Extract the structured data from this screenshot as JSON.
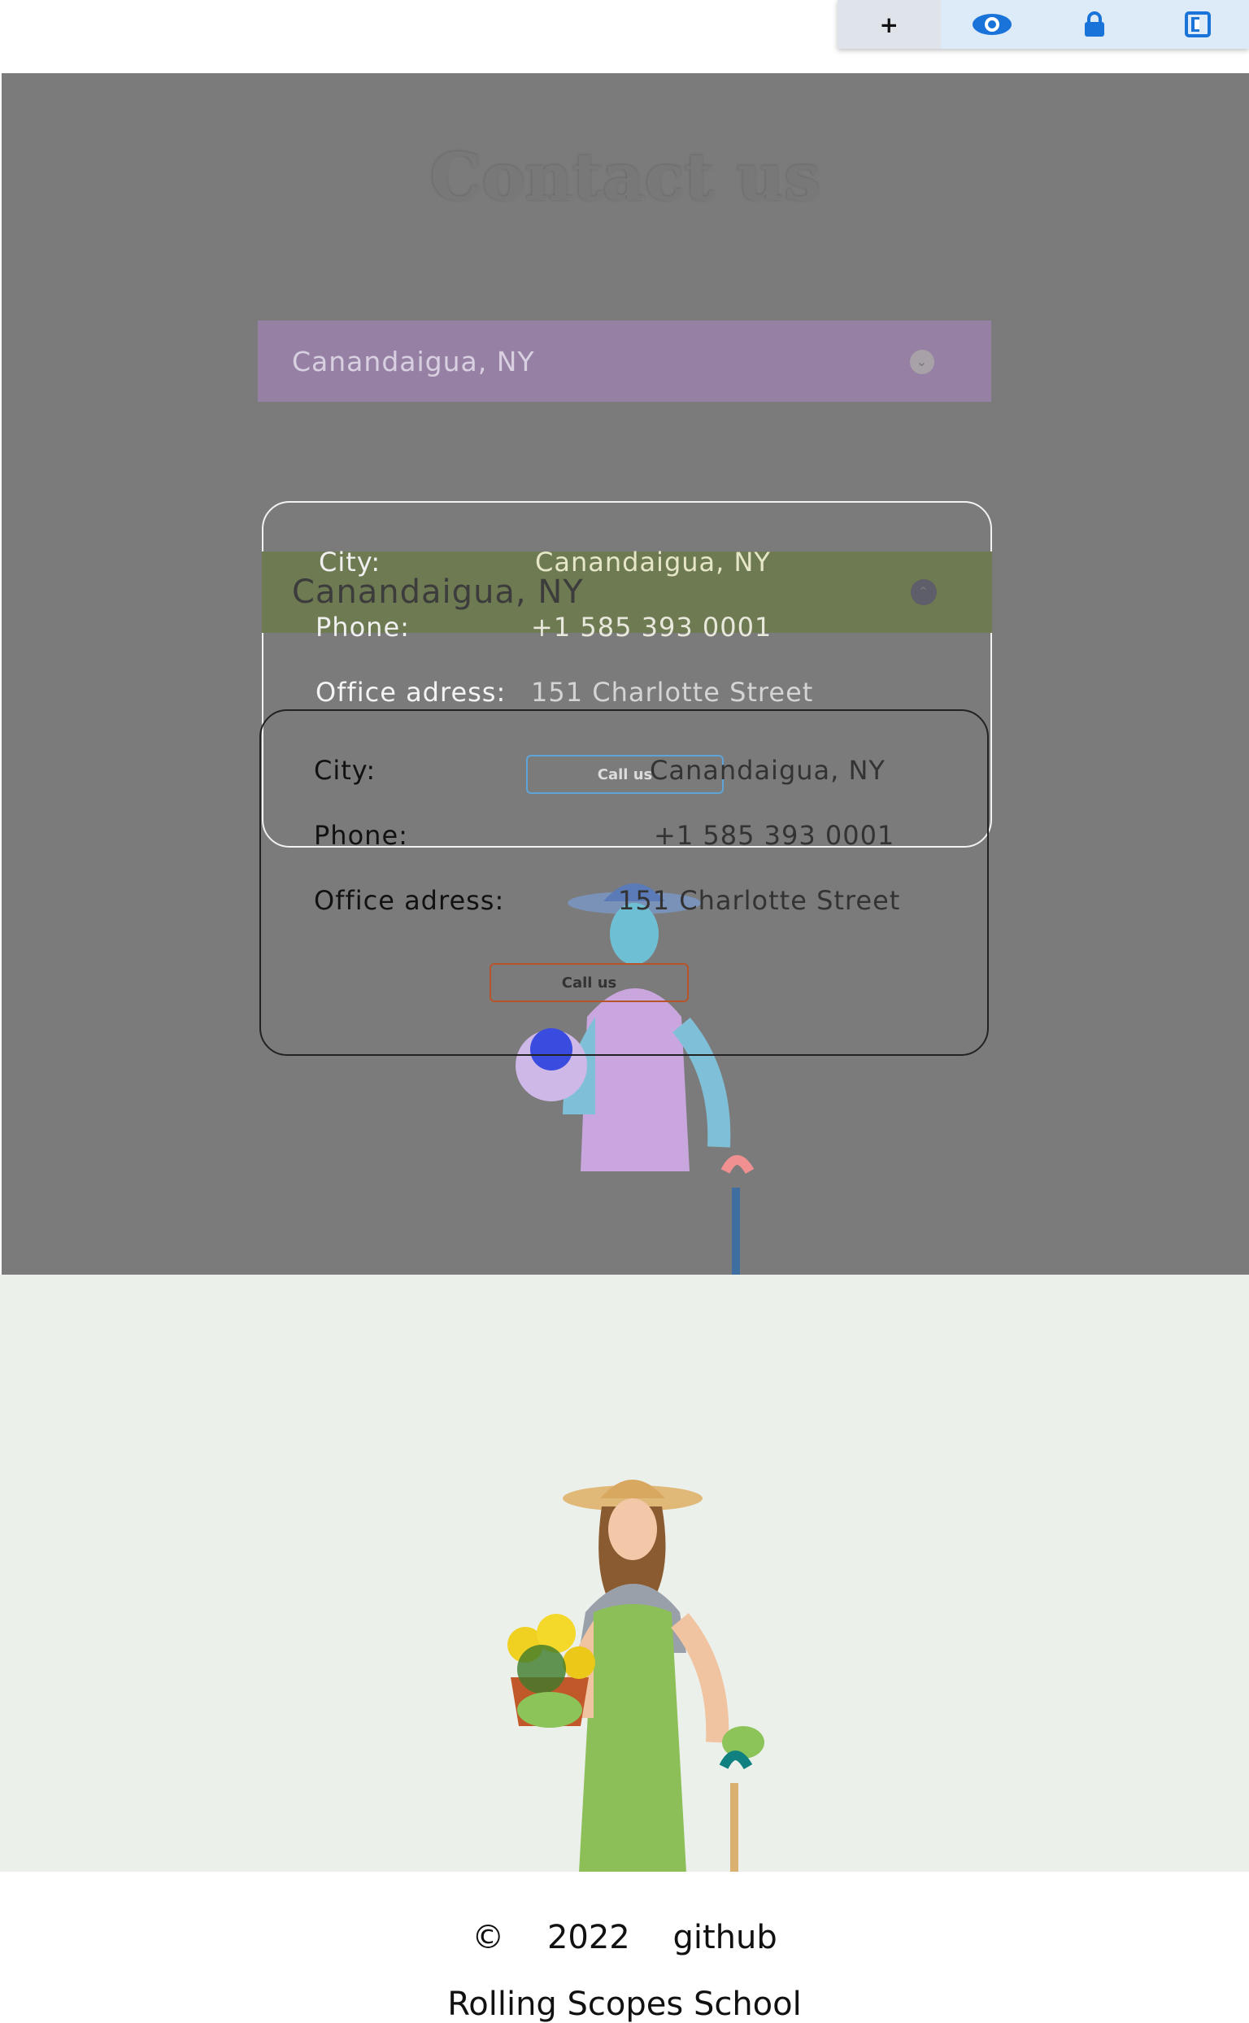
{
  "toolbar": {
    "buttons": [
      {
        "name": "plus-icon",
        "glyph": "+"
      },
      {
        "name": "eye-icon",
        "glyph": "👁"
      },
      {
        "name": "lock-icon",
        "glyph": "🔒"
      },
      {
        "name": "panel-icon",
        "glyph": "◧"
      }
    ]
  },
  "overlay": {
    "title": "Contact us",
    "select_value": "Canandaigua, NY",
    "select_value_2": "Canandaigua, NY",
    "card1": {
      "city_label": "City:",
      "city_value": "Canandaigua, NY",
      "phone_label": "Phone:",
      "phone_value": "+1 585 393 0001",
      "address_label": "Office adress:",
      "address_value": "151 Charlotte Street",
      "call_button": "Call us"
    },
    "card2": {
      "city_label": "City:",
      "city_value": "Canandaigua, NY",
      "phone_label": "Phone:",
      "phone_value": "+1 585 393 0001",
      "address_label": "Office adress:",
      "address_value": "151 Charlotte Street",
      "call_button": "Call us"
    }
  },
  "colors": {
    "overlay_bg": "#7b7b7b",
    "hero_bg": "#ecf0eb",
    "apron_green": "#8cbf57",
    "accent_blue": "#1a73d9"
  },
  "footer": {
    "copyright_symbol": "©",
    "year": "2022",
    "link": "github",
    "school": "Rolling Scopes School"
  }
}
